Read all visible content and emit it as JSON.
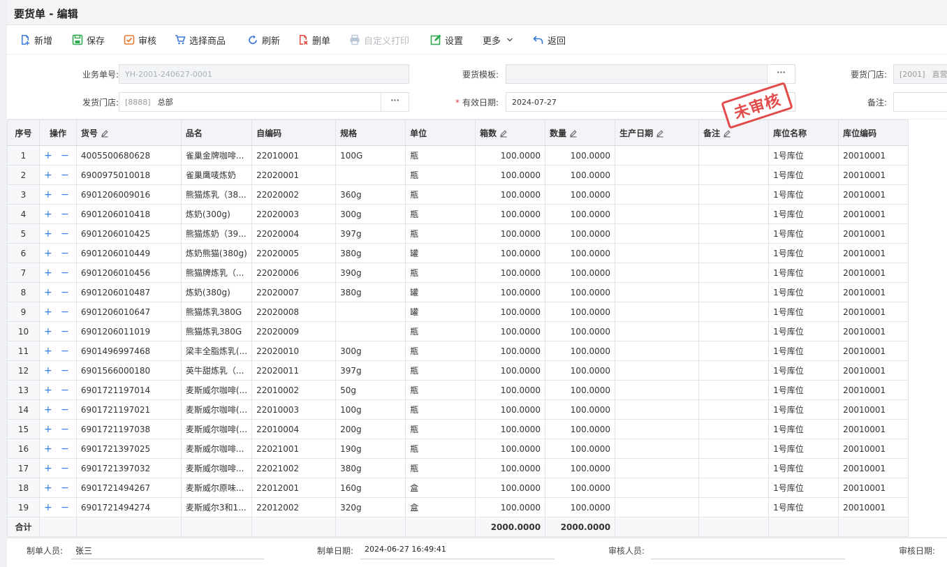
{
  "title": "要货单 - 编辑",
  "toolbar": {
    "new": "新增",
    "save": "保存",
    "audit": "审核",
    "select_goods": "选择商品",
    "refresh": "刷新",
    "delete": "删单",
    "custom_print": "自定义打印",
    "settings": "设置",
    "more": "更多",
    "back": "返回"
  },
  "form": {
    "order_no_label": "业务单号:",
    "order_no_value": "YH-2001-240627-0001",
    "template_label": "要货模板:",
    "template_value": "",
    "req_store_label": "要货门店:",
    "req_store_code": "[2001]",
    "req_store_name": "直营",
    "ship_store_label": "发货门店:",
    "ship_store_code": "[8888]",
    "ship_store_name": "总部",
    "valid_date_label": "有效日期:",
    "valid_date_value": "2024-07-27",
    "remark_label": "备注:",
    "remark_value": "",
    "dots": "···"
  },
  "stamp": "未审核",
  "table": {
    "headers": {
      "idx": "序号",
      "op": "操作",
      "code": "货号",
      "name": "品名",
      "selfcode": "自编码",
      "spec": "规格",
      "unit": "单位",
      "boxes": "箱数",
      "qty": "数量",
      "prod_date": "生产日期",
      "remark": "备注",
      "loc_name": "库位名称",
      "loc_code": "库位编码"
    },
    "op_symbols": "+ −",
    "rows": [
      {
        "idx": "1",
        "code": "4005500680628",
        "name": "雀巢金牌咖啡...",
        "selfcode": "22010001",
        "spec": "100G",
        "unit": "瓶",
        "boxes": "100.0000",
        "qty": "100.0000",
        "prod_date": "",
        "remark": "",
        "loc_name": "1号库位",
        "loc_code": "20010001"
      },
      {
        "idx": "2",
        "code": "6900975010018",
        "name": "雀巢鹰唛炼奶",
        "selfcode": "22020001",
        "spec": "",
        "unit": "瓶",
        "boxes": "100.0000",
        "qty": "100.0000",
        "prod_date": "",
        "remark": "",
        "loc_name": "1号库位",
        "loc_code": "20010001"
      },
      {
        "idx": "3",
        "code": "6901206009016",
        "name": "熊猫炼乳（38...",
        "selfcode": "22020002",
        "spec": "360g",
        "unit": "瓶",
        "boxes": "100.0000",
        "qty": "100.0000",
        "prod_date": "",
        "remark": "",
        "loc_name": "1号库位",
        "loc_code": "20010001"
      },
      {
        "idx": "4",
        "code": "6901206010418",
        "name": "炼奶(300g)",
        "selfcode": "22020003",
        "spec": "300g",
        "unit": "瓶",
        "boxes": "100.0000",
        "qty": "100.0000",
        "prod_date": "",
        "remark": "",
        "loc_name": "1号库位",
        "loc_code": "20010001"
      },
      {
        "idx": "5",
        "code": "6901206010425",
        "name": "熊猫炼奶（39...",
        "selfcode": "22020004",
        "spec": "397g",
        "unit": "瓶",
        "boxes": "100.0000",
        "qty": "100.0000",
        "prod_date": "",
        "remark": "",
        "loc_name": "1号库位",
        "loc_code": "20010001"
      },
      {
        "idx": "6",
        "code": "6901206010449",
        "name": "炼奶熊猫(380g)",
        "selfcode": "22020005",
        "spec": "380g",
        "unit": "罐",
        "boxes": "100.0000",
        "qty": "100.0000",
        "prod_date": "",
        "remark": "",
        "loc_name": "1号库位",
        "loc_code": "20010001"
      },
      {
        "idx": "7",
        "code": "6901206010456",
        "name": "熊猫牌炼乳（...",
        "selfcode": "22020006",
        "spec": "390g",
        "unit": "瓶",
        "boxes": "100.0000",
        "qty": "100.0000",
        "prod_date": "",
        "remark": "",
        "loc_name": "1号库位",
        "loc_code": "20010001"
      },
      {
        "idx": "8",
        "code": "6901206010487",
        "name": "炼奶(380g)",
        "selfcode": "22020007",
        "spec": "380g",
        "unit": "罐",
        "boxes": "100.0000",
        "qty": "100.0000",
        "prod_date": "",
        "remark": "",
        "loc_name": "1号库位",
        "loc_code": "20010001"
      },
      {
        "idx": "9",
        "code": "6901206010647",
        "name": "熊猫炼乳380G",
        "selfcode": "22020008",
        "spec": "",
        "unit": "罐",
        "boxes": "100.0000",
        "qty": "100.0000",
        "prod_date": "",
        "remark": "",
        "loc_name": "1号库位",
        "loc_code": "20010001"
      },
      {
        "idx": "10",
        "code": "6901206011019",
        "name": "熊猫炼乳380G",
        "selfcode": "22020009",
        "spec": "",
        "unit": "瓶",
        "boxes": "100.0000",
        "qty": "100.0000",
        "prod_date": "",
        "remark": "",
        "loc_name": "1号库位",
        "loc_code": "20010001"
      },
      {
        "idx": "11",
        "code": "6901496997468",
        "name": "梁丰全脂炼乳(...",
        "selfcode": "22020010",
        "spec": "300g",
        "unit": "瓶",
        "boxes": "100.0000",
        "qty": "100.0000",
        "prod_date": "",
        "remark": "",
        "loc_name": "1号库位",
        "loc_code": "20010001"
      },
      {
        "idx": "12",
        "code": "6901566000180",
        "name": "英牛甜炼乳（...",
        "selfcode": "22020011",
        "spec": "397g",
        "unit": "瓶",
        "boxes": "100.0000",
        "qty": "100.0000",
        "prod_date": "",
        "remark": "",
        "loc_name": "1号库位",
        "loc_code": "20010001"
      },
      {
        "idx": "13",
        "code": "6901721197014",
        "name": "麦斯威尔咖啡(...",
        "selfcode": "22010002",
        "spec": "50g",
        "unit": "瓶",
        "boxes": "100.0000",
        "qty": "100.0000",
        "prod_date": "",
        "remark": "",
        "loc_name": "1号库位",
        "loc_code": "20010001"
      },
      {
        "idx": "14",
        "code": "6901721197021",
        "name": "麦斯威尔咖啡(...",
        "selfcode": "22010003",
        "spec": "100g",
        "unit": "瓶",
        "boxes": "100.0000",
        "qty": "100.0000",
        "prod_date": "",
        "remark": "",
        "loc_name": "1号库位",
        "loc_code": "20010001"
      },
      {
        "idx": "15",
        "code": "6901721197038",
        "name": "麦斯威尔咖啡(...",
        "selfcode": "22010004",
        "spec": "200g",
        "unit": "瓶",
        "boxes": "100.0000",
        "qty": "100.0000",
        "prod_date": "",
        "remark": "",
        "loc_name": "1号库位",
        "loc_code": "20010001"
      },
      {
        "idx": "16",
        "code": "6901721397025",
        "name": "麦斯威尔咖啡...",
        "selfcode": "22021001",
        "spec": "190g",
        "unit": "瓶",
        "boxes": "100.0000",
        "qty": "100.0000",
        "prod_date": "",
        "remark": "",
        "loc_name": "1号库位",
        "loc_code": "20010001"
      },
      {
        "idx": "17",
        "code": "6901721397032",
        "name": "麦斯威尔咖啡...",
        "selfcode": "22021002",
        "spec": "380g",
        "unit": "瓶",
        "boxes": "100.0000",
        "qty": "100.0000",
        "prod_date": "",
        "remark": "",
        "loc_name": "1号库位",
        "loc_code": "20010001"
      },
      {
        "idx": "18",
        "code": "6901721494267",
        "name": "麦斯威尔原味...",
        "selfcode": "22012001",
        "spec": "160g",
        "unit": "盒",
        "boxes": "100.0000",
        "qty": "100.0000",
        "prod_date": "",
        "remark": "",
        "loc_name": "1号库位",
        "loc_code": "20010001"
      },
      {
        "idx": "19",
        "code": "6901721494274",
        "name": "麦斯威尔3和1...",
        "selfcode": "22012002",
        "spec": "320g",
        "unit": "盒",
        "boxes": "100.0000",
        "qty": "100.0000",
        "prod_date": "",
        "remark": "",
        "loc_name": "1号库位",
        "loc_code": "20010001"
      }
    ],
    "total": {
      "label": "合计",
      "boxes": "2000.0000",
      "qty": "2000.0000"
    }
  },
  "footer": {
    "creator_label": "制单人员:",
    "creator_value": "张三",
    "create_date_label": "制单日期:",
    "create_date_value": "2024-06-27 16:49:41",
    "auditor_label": "审核人员:",
    "auditor_value": "",
    "audit_date_label": "审核日期:"
  }
}
